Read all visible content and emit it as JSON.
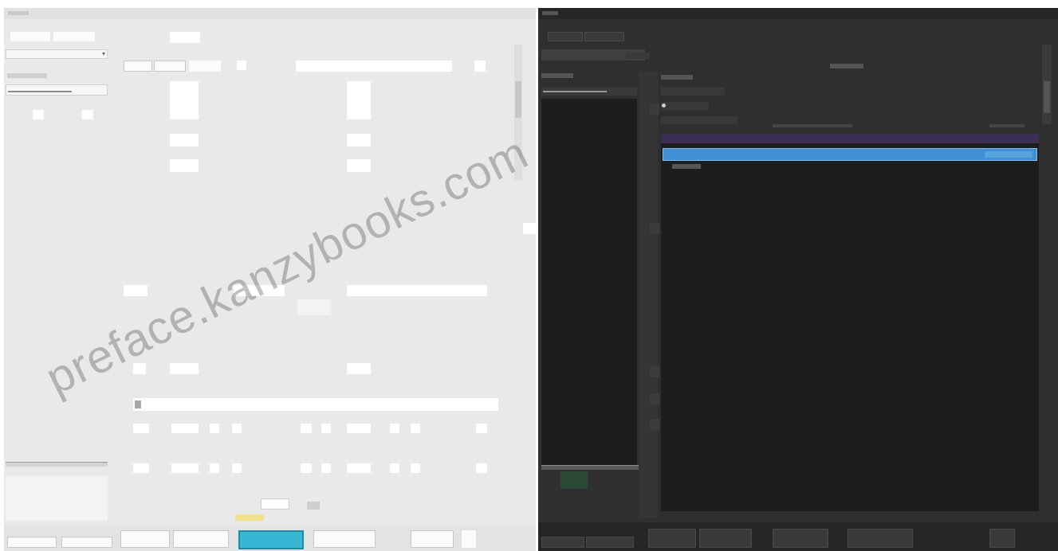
{
  "watermark": "preface.kanzybooks.com",
  "colors": {
    "light_bg": "#e9e9e9",
    "dark_bg": "#2f2f2f",
    "dark_panel": "#1d1d1d",
    "selection_blue": "#3f8fd2",
    "accent_highlight": "#38b6d4",
    "accent_yellow": "#f1e18a",
    "dark_purple": "#3b2f55",
    "dark_green": "#2a4a36"
  },
  "icons": {
    "dropdown": "chevron-down-icon",
    "radio": "radio-icon",
    "checkbox": "checkbox-icon"
  }
}
